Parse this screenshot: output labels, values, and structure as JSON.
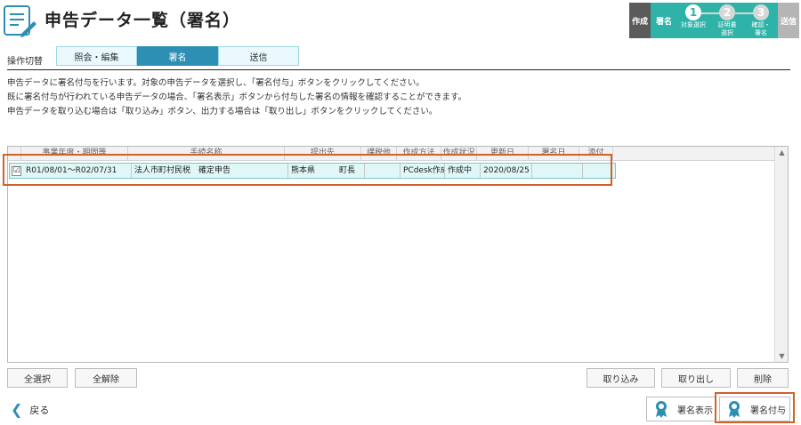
{
  "header": {
    "title": "申告データ一覧（署名）",
    "app_icon": "document-edit-icon"
  },
  "stepper": {
    "create": "作成",
    "sign": "署名",
    "send": "送信",
    "steps": [
      {
        "number": "1",
        "label_lines": [
          "対象選択"
        ]
      },
      {
        "number": "2",
        "label_lines": [
          "証明書",
          "選択"
        ]
      },
      {
        "number": "3",
        "label_lines": [
          "確認・",
          "署名"
        ]
      }
    ]
  },
  "tabs": {
    "label": "操作切替",
    "items": [
      "照会・編集",
      "署名",
      "送信"
    ],
    "active": "署名"
  },
  "description": [
    "申告データに署名付与を行います。対象の申告データを選択し、「署名付与」ボタンをクリックしてください。",
    "既に署名付与が行われている申告データの場合、「署名表示」ボタンから付与した署名の情報を確認することができます。",
    "申告データを取り込む場合は「取り込み」ボタン、出力する場合は「取り出し」ボタンをクリックしてください。"
  ],
  "table": {
    "columns": [
      "事業年度・期間等",
      "手続名称",
      "提出先",
      "課税他",
      "作成方法",
      "作成状況",
      "更新日",
      "署名日",
      "添付"
    ],
    "rows": [
      {
        "checked": "☑",
        "cells": [
          "R01/08/01～R02/07/31",
          "法人市町村民税　確定申告",
          "熊本県　　　町長",
          "",
          "PCdesk作成",
          "作成中",
          "2020/08/25",
          "",
          ""
        ]
      }
    ]
  },
  "buttons": {
    "select_all": "全選択",
    "deselect_all": "全解除",
    "import": "取り込み",
    "export": "取り出し",
    "delete": "削除",
    "back": "戻る",
    "show_signature": "署名表示",
    "add_signature": "署名付与"
  },
  "colors": {
    "accent": "#2fb3a8",
    "tab_active": "#2c8fb3",
    "highlight": "#d1622a"
  }
}
